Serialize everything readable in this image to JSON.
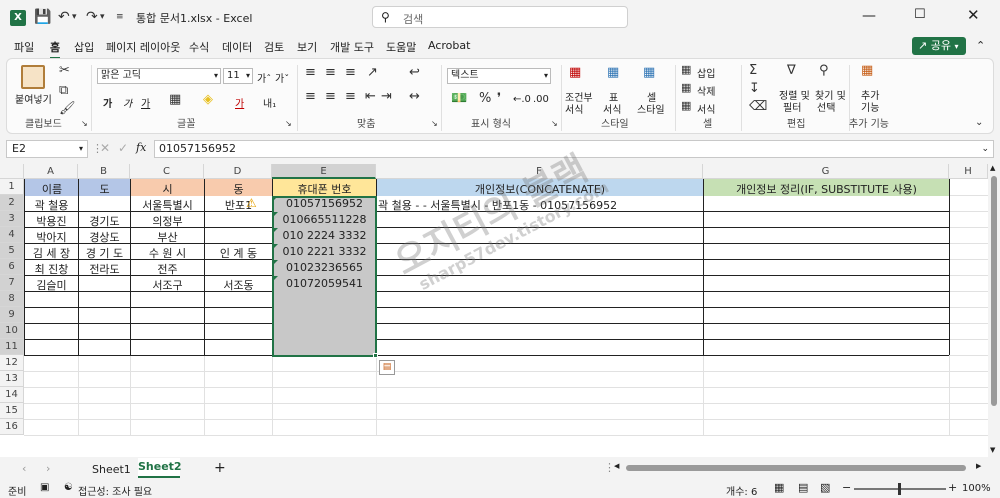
{
  "titlebar": {
    "filename": "통합 문서1.xlsx",
    "sep": "-",
    "app": "Excel",
    "search_placeholder": "검색"
  },
  "menu": [
    "파일",
    "홈",
    "삽입",
    "페이지 레이아웃",
    "수식",
    "데이터",
    "검토",
    "보기",
    "개발 도구",
    "도움말",
    "Acrobat"
  ],
  "share_label": "공유",
  "ribbon": {
    "paste": "붙여넣기",
    "font_name": "맑은 고딕",
    "font_size": "11",
    "number_format": "텍스트",
    "conditional": [
      "조건부",
      "서식"
    ],
    "table_fmt": [
      "표",
      "서식"
    ],
    "cell_style": [
      "셀",
      "스타일"
    ],
    "insert": "삽입",
    "delete": "삭제",
    "format": "서식",
    "sort": [
      "정렬 및",
      "필터"
    ],
    "find": [
      "찾기 및",
      "선택"
    ],
    "addins": [
      "추가",
      "기능"
    ],
    "groups": [
      "클립보드",
      "글꼴",
      "맞춤",
      "표시 형식",
      "스타일",
      "셀",
      "편집",
      "추가 기능"
    ]
  },
  "formula": {
    "namebox": "E2",
    "fx": "fx",
    "content": "01057156952"
  },
  "columns": [
    "A",
    "B",
    "C",
    "D",
    "E",
    "F",
    "G",
    "H"
  ],
  "rows": [
    "1",
    "2",
    "3",
    "4",
    "5",
    "6",
    "7",
    "8",
    "9",
    "10",
    "11",
    "12",
    "13",
    "14",
    "15",
    "16"
  ],
  "headers": {
    "a": "이름",
    "b": "도",
    "c": "시",
    "d": "동",
    "e": "휴대폰 번호",
    "f": "개인정보(CONCATENATE)",
    "g": "개인정보 정리(IF, SUBSTITUTE 사용)"
  },
  "data": [
    {
      "a": "곽 철용",
      "b": "",
      "c": "서울특별시",
      "d": "반포1",
      "e": "01057156952",
      "f": "곽 철용 -  - 서울특별시 - 반포1동 - 01057156952"
    },
    {
      "a": "박용진",
      "b": "경기도",
      "c": "의정부",
      "d": "",
      "e": "010665511228",
      "f": ""
    },
    {
      "a": "박아지",
      "b": "경상도",
      "c": "부산",
      "d": "",
      "e": "010 2224 3332",
      "f": ""
    },
    {
      "a": "김 세 장",
      "b": "경 기 도",
      "c": "수 원 시",
      "d": "인 계 동",
      "e": "010 2221 3332",
      "f": ""
    },
    {
      "a": "최 진창",
      "b": "전라도",
      "c": "전주",
      "d": "",
      "e": "01023236565",
      "f": ""
    },
    {
      "a": "김슬미",
      "b": "",
      "c": "서조구",
      "d": "서조동",
      "e": "01072059541",
      "f": ""
    }
  ],
  "watermark": {
    "line1": "오지티의 블랙",
    "line2": "sharp57dev.tistory.com"
  },
  "sheets": [
    "Sheet1",
    "Sheet2"
  ],
  "active_sheet": "Sheet2",
  "status": {
    "ready": "준비",
    "accessibility": "접근성: 조사 필요",
    "count": "개수: 6",
    "zoom": "100%"
  },
  "colors": {
    "excel_green": "#217346",
    "header_a": "#b4c6e7",
    "header_c": "#f8cbad",
    "header_e": "#ffe699",
    "header_f": "#bdd7ee",
    "header_g": "#c6e0b4",
    "selected": "#c8c8c8"
  }
}
